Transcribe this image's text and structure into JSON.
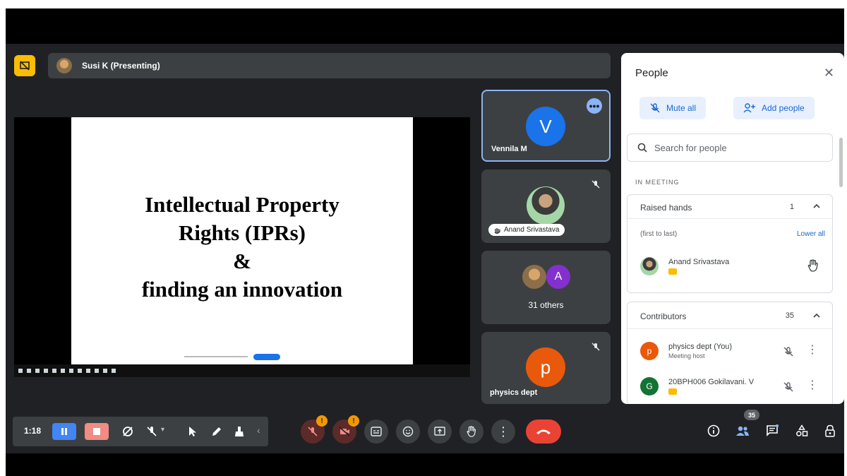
{
  "presenter": {
    "label": "Susi K (Presenting)"
  },
  "slide": {
    "lines": [
      "Intellectual Property",
      "Rights (IPRs)",
      "&",
      "finding an innovation"
    ]
  },
  "tiles": [
    {
      "name": "Vennila M",
      "initial": "V",
      "color": "#1a73e8"
    },
    {
      "name": "Anand Srivastava"
    },
    {
      "others": "31 others",
      "initial": "A",
      "color": "#8430ce"
    },
    {
      "name": "physics dept",
      "initial": "p",
      "color": "#e8590c"
    }
  ],
  "panel": {
    "title": "People",
    "mute_all": "Mute all",
    "add_people": "Add people",
    "search_placeholder": "Search for people",
    "section": "IN MEETING",
    "raised_hands": {
      "label": "Raised hands",
      "count": "1",
      "order": "(first to last)",
      "lower_all": "Lower all",
      "person": "Anand Srivastava"
    },
    "contributors": {
      "label": "Contributors",
      "count": "35",
      "people": [
        {
          "name": "physics dept (You)",
          "sub": "Meeting host",
          "initial": "p",
          "color": "#e8590c"
        },
        {
          "name": "20BPH006 Gokilavani. V",
          "initial": "G",
          "color": "#137333"
        }
      ]
    }
  },
  "controls": {
    "timer": "1:18",
    "mic_badge": "!",
    "cam_badge": "!",
    "people_count": "35"
  },
  "colors": {
    "accent": "#8ab4f8",
    "hangup": "#ea4335",
    "pause": "#4285f4",
    "stop": "#f28b82",
    "warning": "#f29900"
  }
}
